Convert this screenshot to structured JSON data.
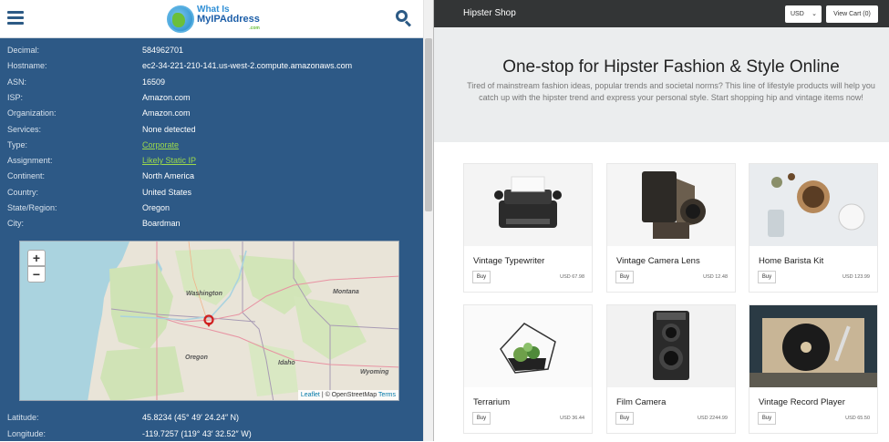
{
  "left": {
    "logo": {
      "line1": "What Is",
      "line2": "MyIPAddress",
      "line3": ".com"
    },
    "rows": [
      {
        "key": "Decimal:",
        "value": "584962701",
        "link": false
      },
      {
        "key": "Hostname:",
        "value": "ec2-34-221-210-141.us-west-2.compute.amazonaws.com",
        "link": false
      },
      {
        "key": "ASN:",
        "value": "16509",
        "link": false
      },
      {
        "key": "ISP:",
        "value": "Amazon.com",
        "link": false
      },
      {
        "key": "Organization:",
        "value": "Amazon.com",
        "link": false
      },
      {
        "key": "Services:",
        "value": "None detected",
        "link": false
      },
      {
        "key": "Type:",
        "value": "Corporate",
        "link": true
      },
      {
        "key": "Assignment:",
        "value": "Likely Static IP",
        "link": true
      },
      {
        "key": "Continent:",
        "value": "North America",
        "link": false
      },
      {
        "key": "Country:",
        "value": "United States",
        "link": false
      },
      {
        "key": "State/Region:",
        "value": "Oregon",
        "link": false
      },
      {
        "key": "City:",
        "value": "Boardman",
        "link": false
      }
    ],
    "rows_bottom": [
      {
        "key": "Latitude:",
        "value": "45.8234  (45° 49′ 24.24″ N)"
      },
      {
        "key": "Longitude:",
        "value": "-119.7257  (119° 43′ 32.52″ W)"
      }
    ],
    "map": {
      "zoom_in": "+",
      "zoom_out": "−",
      "labels": {
        "washington": "Washington",
        "montana": "Montana",
        "oregon": "Oregon",
        "idaho": "Idaho",
        "wyoming": "Wyoming"
      },
      "attribution_leaflet": "Leaflet",
      "attribution_osm": "| © OpenStreetMap",
      "attribution_terms": "Terms"
    },
    "colors": {
      "panel": "#2d5986",
      "link": "#9cd94c"
    }
  },
  "right": {
    "shop_title": "Hipster Shop",
    "currency": "USD",
    "view_cart": "View Cart (0)",
    "hero_title": "One-stop for Hipster Fashion & Style Online",
    "hero_sub": "Tired of mainstream fashion ideas, popular trends and societal norms? This line of lifestyle products will help you catch up with the hipster trend and express your personal style. Start shopping hip and vintage items now!",
    "products": [
      {
        "name": "Vintage Typewriter",
        "price": "USD 67.98",
        "buy": "Buy",
        "icon": "typewriter-image"
      },
      {
        "name": "Vintage Camera Lens",
        "price": "USD 12.48",
        "buy": "Buy",
        "icon": "camera-image"
      },
      {
        "name": "Home Barista Kit",
        "price": "USD 123.99",
        "buy": "Buy",
        "icon": "barista-kit-image"
      },
      {
        "name": "Terrarium",
        "price": "USD 36.44",
        "buy": "Buy",
        "icon": "terrarium-image"
      },
      {
        "name": "Film Camera",
        "price": "USD 2244.99",
        "buy": "Buy",
        "icon": "film-camera-image"
      },
      {
        "name": "Vintage Record Player",
        "price": "USD 65.50",
        "buy": "Buy",
        "icon": "record-player-image"
      }
    ]
  }
}
